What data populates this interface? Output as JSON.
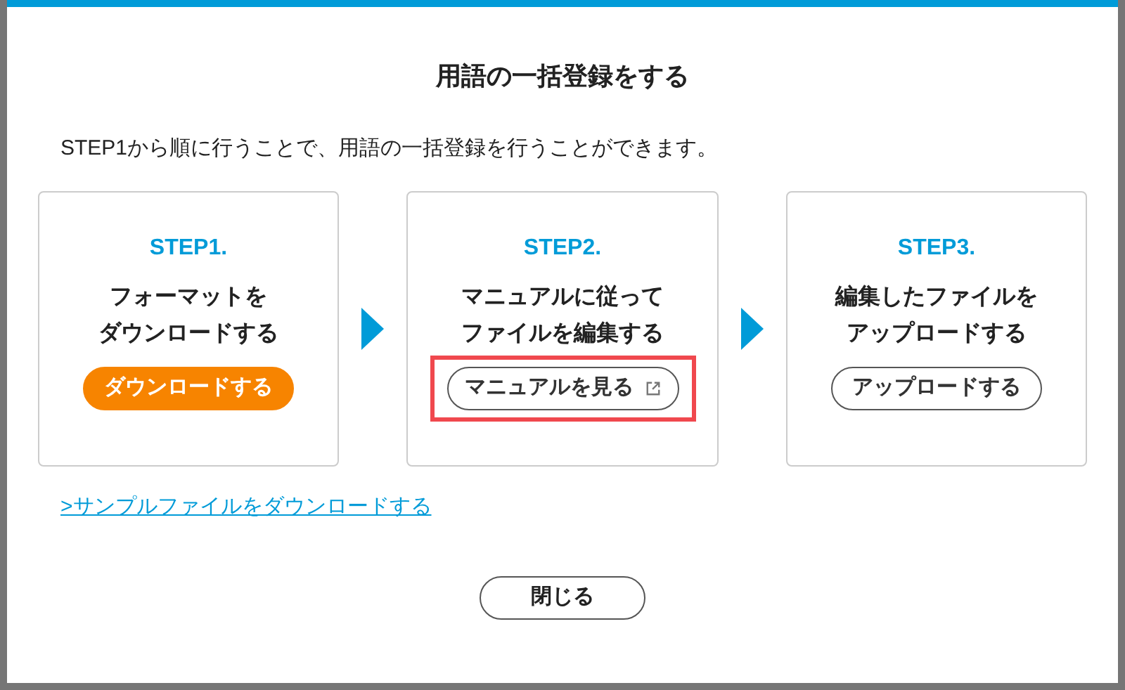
{
  "dialog": {
    "title": "用語の一括登録をする",
    "description": "STEP1から順に行うことで、用語の一括登録を行うことができます。"
  },
  "steps": [
    {
      "step": "STEP1.",
      "heading": [
        "フォーマットを",
        "ダウンロードする"
      ],
      "button": {
        "label": "ダウンロードする",
        "kind": "primary",
        "external": false,
        "highlighted": false
      }
    },
    {
      "step": "STEP2.",
      "heading": [
        "マニュアルに従って",
        "ファイルを編集する"
      ],
      "button": {
        "label": "マニュアルを見る",
        "kind": "outline",
        "external": true,
        "highlighted": true
      }
    },
    {
      "step": "STEP3.",
      "heading": [
        "編集したファイルを",
        "アップロードする"
      ],
      "button": {
        "label": "アップロードする",
        "kind": "outline",
        "external": false,
        "highlighted": false
      }
    }
  ],
  "sample_link": ">サンプルファイルをダウンロードする",
  "close_button": "閉じる"
}
